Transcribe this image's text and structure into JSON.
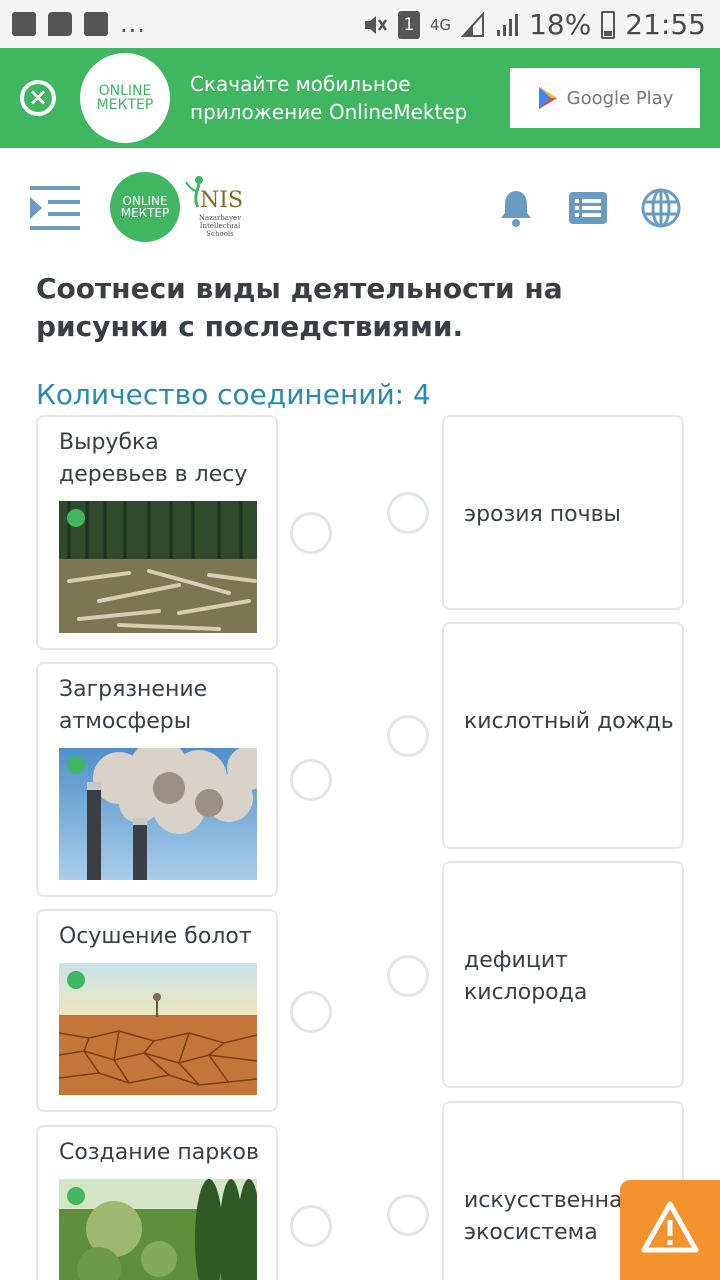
{
  "statusbar": {
    "signal_label": "4G",
    "sim_badge": "1",
    "battery": "18%",
    "time": "21:55",
    "dots": "..."
  },
  "banner": {
    "logo_line1": "ONLINE",
    "logo_line2": "МЕКТЕР",
    "text_line1": "Скачайте мобильное",
    "text_line2": "приложение OnlineMektep",
    "store_label": "Google Play"
  },
  "header": {
    "logo_line1": "ONLINE",
    "logo_line2": "МЕКТЕР",
    "nis_title": "NIS",
    "nis_subtitle": "Nazarbayev Intellectual Schools"
  },
  "task": {
    "question": "Соотнеси виды деятельности на рисунки с последствиями.",
    "connections_label": "Количество соединений: 4"
  },
  "left_items": [
    {
      "label": "Вырубка деревьев в лесу"
    },
    {
      "label": "Загрязнение атмосферы"
    },
    {
      "label": "Осушение болот"
    },
    {
      "label": "Создание парков"
    }
  ],
  "right_items": [
    {
      "label": "эрозия почвы"
    },
    {
      "label": "кислотный дождь"
    },
    {
      "label": "дефицит кислорода"
    },
    {
      "label": "искусственная экосистема"
    }
  ],
  "colors": {
    "brand_green": "#3fb65f",
    "accent_blue": "#2a8bb0",
    "report_orange": "#f4922e"
  },
  "icons": [
    "close-icon",
    "google-play-icon",
    "menu-icon",
    "bell-icon",
    "list-icon",
    "globe-icon",
    "warning-icon"
  ]
}
